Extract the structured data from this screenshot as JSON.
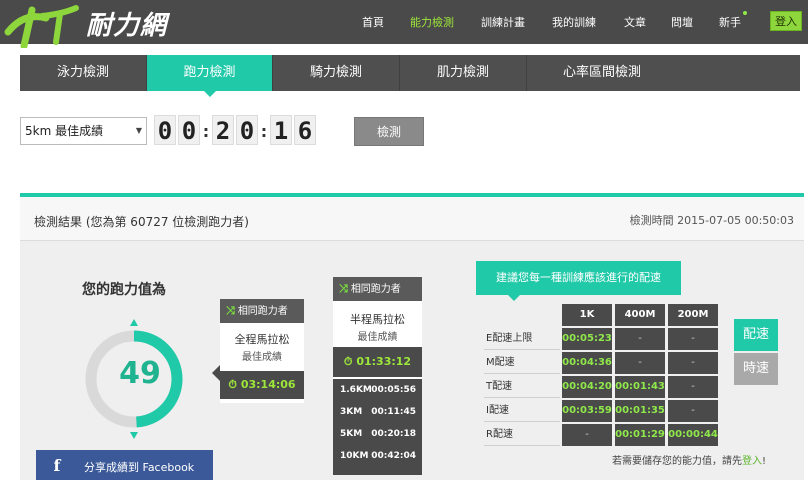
{
  "brand": {
    "name": "耐力網",
    "accent": "#8dd73d",
    "teal": "#20c9a8"
  },
  "nav": {
    "items": [
      {
        "label": "首頁"
      },
      {
        "label": "能力檢測",
        "active": true
      },
      {
        "label": "訓練計畫"
      },
      {
        "label": "我的訓練"
      },
      {
        "label": "文章"
      },
      {
        "label": "問壇"
      },
      {
        "label": "新手"
      }
    ],
    "login_label": "登入"
  },
  "tabs": [
    {
      "label": "泳力檢測"
    },
    {
      "label": "跑力檢測",
      "active": true
    },
    {
      "label": "騎力檢測"
    },
    {
      "label": "肌力檢測"
    },
    {
      "label": "心率區間檢測"
    }
  ],
  "form": {
    "distance_selected": "5km 最佳成績",
    "time_digits": [
      "0",
      "0",
      "2",
      "0",
      "1",
      "6"
    ],
    "check_label": "檢測"
  },
  "result": {
    "title": "檢測結果 (您為第 60727 位檢測跑力者)",
    "time_label": "檢測時間 2015-07-05 00:50:03",
    "score_label": "您的跑力值為",
    "score": "49",
    "score_fraction": 0.49,
    "facebook_label": "分享成績到 Facebook",
    "card_marathon": {
      "head": "相同跑力者",
      "title": "全程馬拉松",
      "subtitle": "最佳成績",
      "time": "03:14:06"
    },
    "card_half": {
      "head": "相同跑力者",
      "title": "半程馬拉松",
      "subtitle": "最佳成績",
      "time": "01:33:12",
      "splits": [
        {
          "distance": "1.6KM",
          "time": "00:05:56"
        },
        {
          "distance": "3KM",
          "time": "00:11:45"
        },
        {
          "distance": "5KM",
          "time": "00:20:18"
        },
        {
          "distance": "10KM",
          "time": "00:42:04"
        }
      ]
    }
  },
  "pace": {
    "banner": "建議您每一種訓練應該進行的配速",
    "columns": [
      "1K",
      "400M",
      "200M"
    ],
    "rows": [
      {
        "label": "E配速上限",
        "values": [
          "00:05:23",
          "-",
          "-"
        ]
      },
      {
        "label": "M配速",
        "values": [
          "00:04:36",
          "-",
          "-"
        ]
      },
      {
        "label": "T配速",
        "values": [
          "00:04:20",
          "00:01:43",
          "-"
        ]
      },
      {
        "label": "I配速",
        "values": [
          "00:03:59",
          "00:01:35",
          "-"
        ]
      },
      {
        "label": "R配速",
        "values": [
          "-",
          "00:01:29",
          "00:00:44"
        ]
      }
    ],
    "mode_pace": "配速",
    "mode_speed": "時速",
    "note_prefix": "若需要儲存您的能力值，請先",
    "note_link": "登入",
    "note_suffix": "!"
  }
}
